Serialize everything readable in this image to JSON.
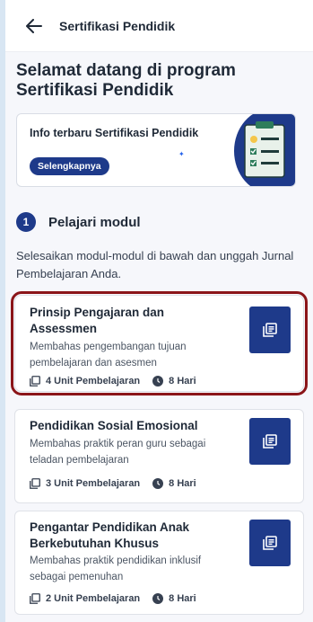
{
  "header": {
    "title": "Sertifikasi Pendidik",
    "back_icon": "arrow-left-icon"
  },
  "welcome": {
    "line1": "Selamat datang di program",
    "line2": "Sertifikasi Pendidik"
  },
  "info_card": {
    "title": "Info terbaru Sertifikasi Pendidik",
    "button_label": "Selengkapnya",
    "illustration_icon": "clipboard-checklist-icon"
  },
  "step": {
    "number": "1",
    "label": "Pelajari modul",
    "description": "Selesaikan modul-modul di bawah dan unggah Jurnal Pembelajaran Anda."
  },
  "modules": [
    {
      "title": "Prinsip Pengajaran dan Assessmen",
      "description": "Membahas pengembangan tujuan pembelajaran dan asesmen",
      "units": "4 Unit Pembelajaran",
      "duration": "8 Hari",
      "selected": true
    },
    {
      "title": "Pendidikan Sosial Emosional",
      "description": "Membahas praktik peran guru sebagai teladan pembelajaran",
      "units": "3 Unit Pembelajaran",
      "duration": "8 Hari",
      "selected": false
    },
    {
      "title": "Pengantar Pendidikan Anak Berkebutuhan Khusus",
      "description": "Membahas praktik pendidikan inklusif sebagai pemenuhan",
      "units": "2 Unit Pembelajaran",
      "duration": "8 Hari",
      "selected": false
    }
  ],
  "colors": {
    "primary": "#1e3a8a",
    "highlight_outline": "#8b1519"
  }
}
